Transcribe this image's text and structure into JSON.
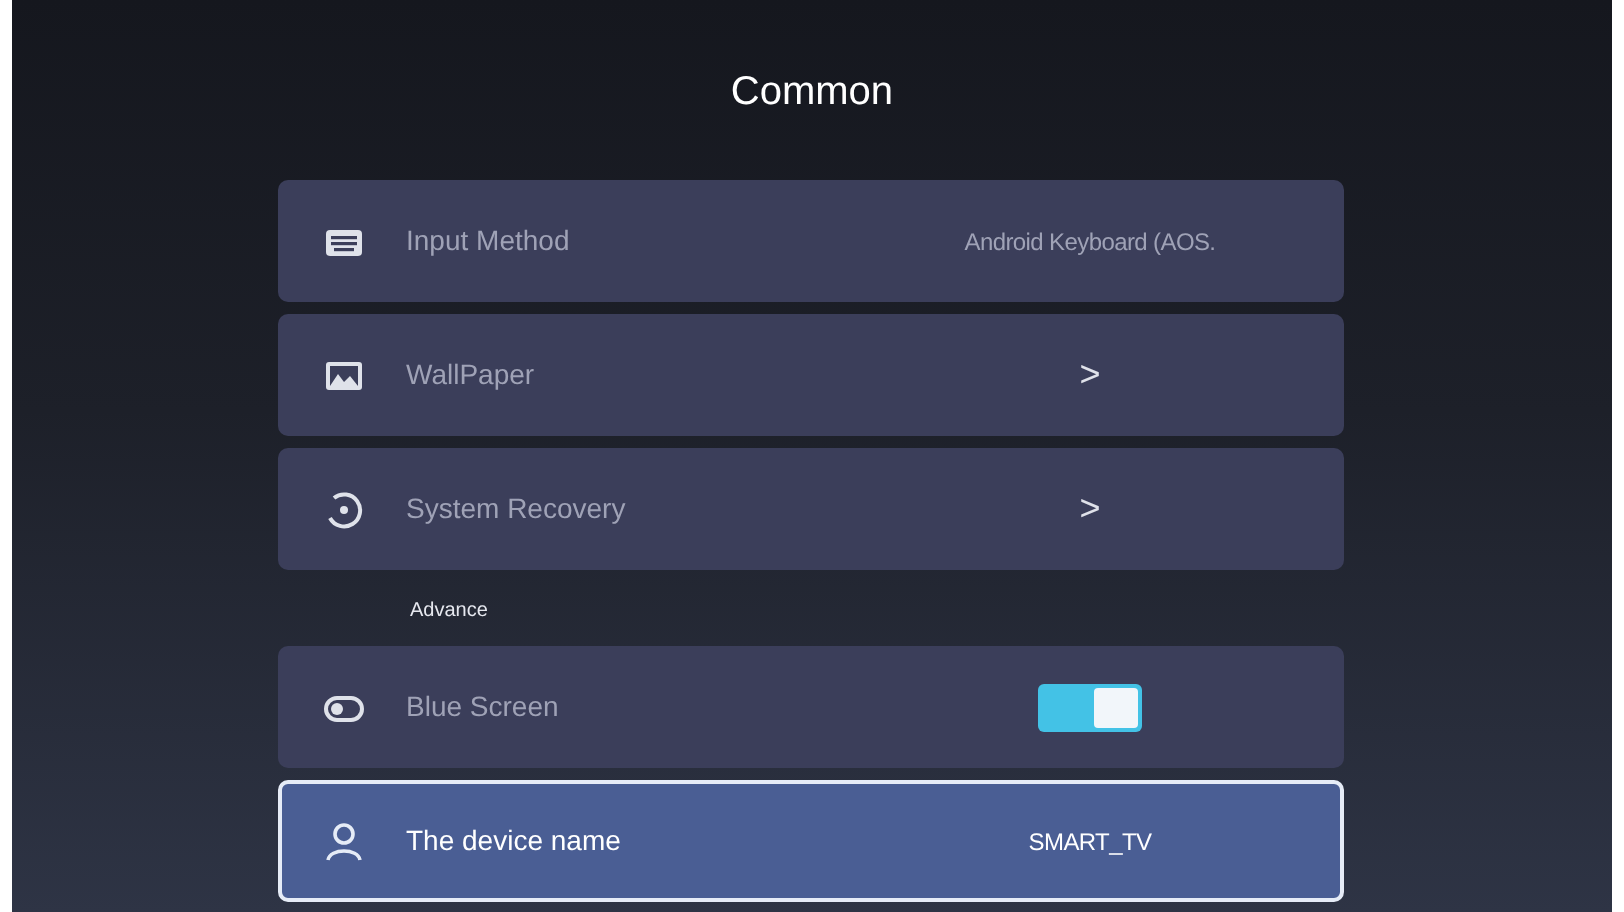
{
  "title": "Common",
  "sections": [
    {
      "items": [
        {
          "kind": "value",
          "label": "Input Method",
          "value": "Android Keyboard (AOS.",
          "selected": false
        },
        {
          "kind": "link",
          "label": "WallPaper",
          "chevron": ">",
          "selected": false
        },
        {
          "kind": "link",
          "label": "System Recovery",
          "chevron": ">",
          "selected": false
        }
      ]
    },
    {
      "header": "Advance",
      "items": [
        {
          "kind": "toggle",
          "label": "Blue Screen",
          "on": true,
          "selected": false
        },
        {
          "kind": "value",
          "label": "The device name",
          "value": "SMART_TV",
          "selected": true
        }
      ]
    }
  ]
}
